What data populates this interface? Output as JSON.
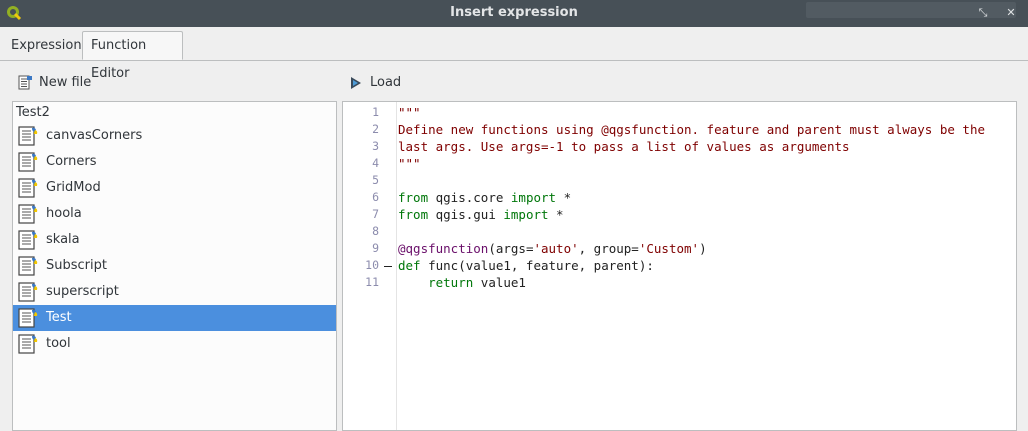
{
  "window": {
    "title": "Insert expression"
  },
  "tabs": [
    {
      "label": "Expression"
    },
    {
      "label": "Function Editor"
    }
  ],
  "toolbar": {
    "new_file_label": "New file",
    "load_label": "Load"
  },
  "file_list": {
    "header": "Test2",
    "items": [
      {
        "label": "canvasCorners"
      },
      {
        "label": "Corners"
      },
      {
        "label": "GridMod"
      },
      {
        "label": "hoola"
      },
      {
        "label": "skala"
      },
      {
        "label": "Subscript"
      },
      {
        "label": "superscript"
      },
      {
        "label": "Test",
        "selected": true
      },
      {
        "label": "tool"
      }
    ]
  },
  "editor": {
    "line_numbers": [
      "1",
      "2",
      "3",
      "4",
      "5",
      "6",
      "7",
      "8",
      "9",
      "10",
      "11"
    ],
    "lines": [
      "\"\"\"",
      "Define new functions using @qgsfunction. feature and parent must always be the",
      "last args. Use args=-1 to pass a list of values as arguments",
      "\"\"\"",
      "",
      "from qgis.core import *",
      "from qgis.gui import *",
      "",
      "@qgsfunction(args='auto', group='Custom')",
      "def func(value1, feature, parent):",
      "    return value1"
    ]
  },
  "colors": {
    "selection": "#4b8fde",
    "titlebar": "#475057",
    "string": "#7f0000",
    "keyword": "#00770a",
    "decorator": "#6a0f6a",
    "line_number": "#8c8cad"
  },
  "icons": {
    "app": "qgis-icon",
    "file": "python-file-icon",
    "load": "load-icon"
  }
}
